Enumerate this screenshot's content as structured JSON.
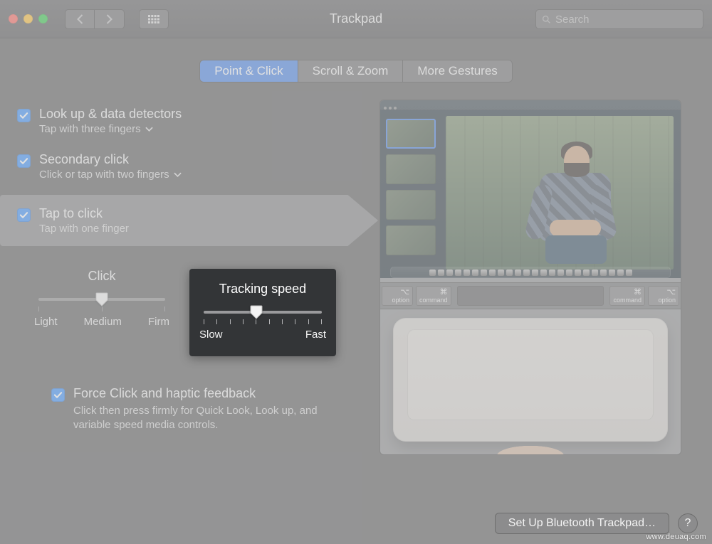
{
  "window": {
    "title": "Trackpad",
    "search_placeholder": "Search"
  },
  "tabs": {
    "point_click": "Point & Click",
    "scroll_zoom": "Scroll & Zoom",
    "more_gestures": "More Gestures",
    "active": "point_click"
  },
  "options": {
    "lookup": {
      "title": "Look up & data detectors",
      "subtitle": "Tap with three fingers",
      "checked": true,
      "has_menu": true
    },
    "secondary": {
      "title": "Secondary click",
      "subtitle": "Click or tap with two fingers",
      "checked": true,
      "has_menu": true
    },
    "tap_to_click": {
      "title": "Tap to click",
      "subtitle": "Tap with one finger",
      "checked": true,
      "highlighted": true
    },
    "force_click": {
      "title": "Force Click and haptic feedback",
      "subtitle": "Click then press firmly for Quick Look, Look up, and variable speed media controls.",
      "checked": true
    }
  },
  "sliders": {
    "click": {
      "title": "Click",
      "ticks": 3,
      "value_index": 1,
      "labels": [
        "Light",
        "Medium",
        "Firm"
      ]
    },
    "tracking": {
      "title": "Tracking speed",
      "ticks": 10,
      "value_index": 4,
      "labels": [
        "Slow",
        "Fast"
      ],
      "highlight": true
    }
  },
  "keyboard_keys": {
    "left": [
      {
        "sym": "⌥",
        "label": "option"
      },
      {
        "sym": "⌘",
        "label": "command"
      }
    ],
    "right": [
      {
        "sym": "⌘",
        "label": "command"
      },
      {
        "sym": "⌥",
        "label": "option"
      }
    ]
  },
  "preview": {
    "thumb_count": 4,
    "selected_thumb": 0,
    "dock_icon_count": 24
  },
  "bottom": {
    "setup_button": "Set Up Bluetooth Trackpad…",
    "help": "?"
  },
  "watermark": "www.deuaq.com"
}
